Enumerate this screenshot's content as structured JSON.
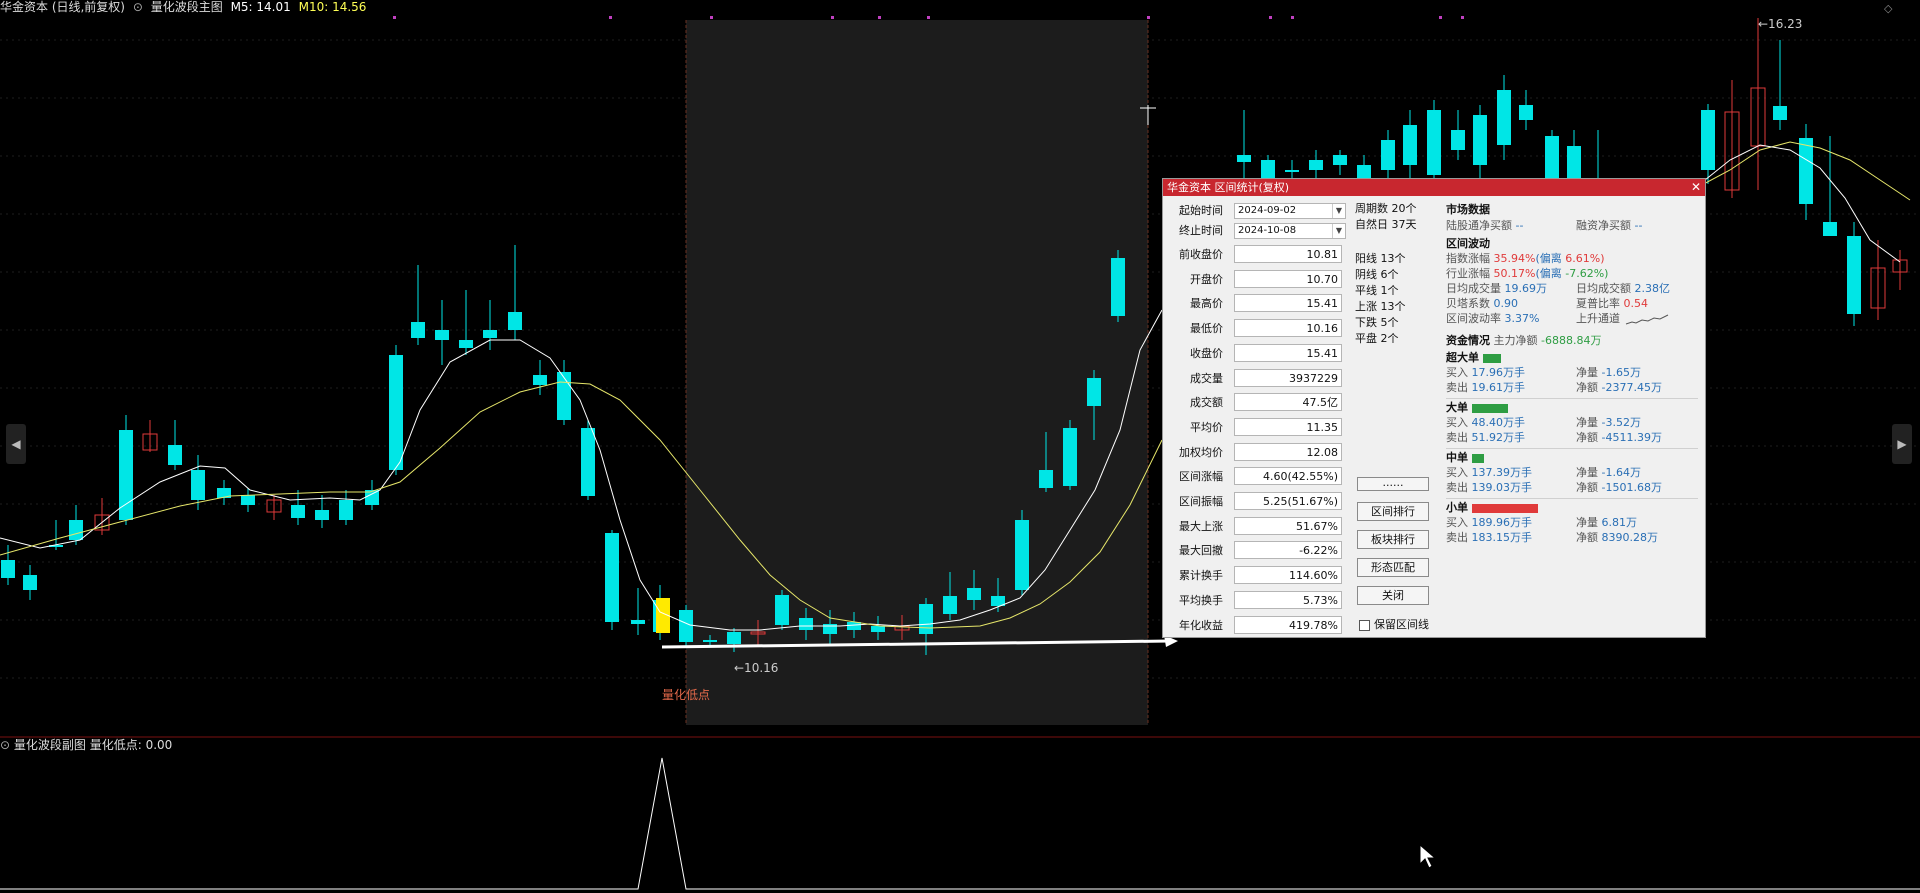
{
  "topbar": {
    "stock": "华金资本 (日线,前复权)",
    "indicator": "量化波段主图",
    "ma5": "M5: 14.01",
    "ma10": "M10: 14.56"
  },
  "subbar": {
    "indicator": "量化波段副图",
    "value": "量化低点: 0.00"
  },
  "chart_labels": {
    "low_point": "量化低点",
    "low_price": "←10.16",
    "high_price": "←16.23"
  },
  "colors": {
    "up": "#e03a3a",
    "down": "#00e6e6",
    "ma5": "#ffffff",
    "ma10": "#e6e66a",
    "dialog_title": "#c8272f"
  },
  "dialog": {
    "title": "华金资本 区间统计(复权)",
    "close": "✕",
    "start_label": "起始时间",
    "start_value": "2024-09-02",
    "end_label": "终止时间",
    "end_value": "2024-10-08",
    "fields": [
      {
        "label": "前收盘价",
        "value": "10.81"
      },
      {
        "label": "开盘价",
        "value": "10.70"
      },
      {
        "label": "最高价",
        "value": "15.41"
      },
      {
        "label": "最低价",
        "value": "10.16"
      },
      {
        "label": "收盘价",
        "value": "15.41"
      },
      {
        "label": "成交量",
        "value": "3937229"
      },
      {
        "label": "成交额",
        "value": "47.5亿"
      },
      {
        "label": "平均价",
        "value": "11.35"
      },
      {
        "label": "加权均价",
        "value": "12.08"
      },
      {
        "label": "区间涨幅",
        "value": "4.60(42.55%)"
      },
      {
        "label": "区间振幅",
        "value": "5.25(51.67%)"
      },
      {
        "label": "最大上涨",
        "value": "51.67%"
      },
      {
        "label": "最大回撤",
        "value": "-6.22%"
      },
      {
        "label": "累计换手",
        "value": "114.60%"
      },
      {
        "label": "平均换手",
        "value": "5.73%"
      },
      {
        "label": "年化收益",
        "value": "419.78%"
      }
    ],
    "stats_top": [
      "周期数 20个",
      "自然日 37天"
    ],
    "stats_mid": [
      "阳线 13个",
      "阴线 6个",
      "平线 1个",
      "上涨 13个",
      "下跌 5个",
      "平盘 2个"
    ],
    "buttons": {
      "more": "......",
      "range_rank": "区间排行",
      "sector_rank": "板块排行",
      "pattern": "形态匹配",
      "close": "关闭"
    },
    "keep_line": "保留区间线",
    "market": {
      "title": "市场数据",
      "hk_label": "陆股通净买额",
      "hk_value": "--",
      "margin_label": "融资净买额",
      "margin_value": "--"
    },
    "volatility": {
      "title": "区间波动",
      "index_label": "指数涨幅",
      "index_value": "35.94%",
      "index_dev": "(偏离",
      "index_dev_value": "6.61%)",
      "industry_label": "行业涨幅",
      "industry_value": "50.17%",
      "industry_dev": "(偏离",
      "industry_dev_value": "-7.62%)",
      "avg_vol_label": "日均成交量",
      "avg_vol_value": "19.69万",
      "avg_amt_label": "日均成交额",
      "avg_amt_value": "2.38亿",
      "beta_label": "贝塔系数",
      "beta_value": "0.90",
      "sharpe_label": "夏普比率",
      "sharpe_value": "0.54",
      "vol_rate_label": "区间波动率",
      "vol_rate_value": "3.37%",
      "channel": "上升通道"
    },
    "funds": {
      "title": "资金情况",
      "main_label": "主力净额",
      "main_value": "-6888.84万",
      "groups": [
        {
          "name": "超大单",
          "bar_color": "#2e9d43",
          "buy": "17.96万手",
          "sell": "19.61万手",
          "net_qty": "-1.65万",
          "net_amt": "-2377.45万"
        },
        {
          "name": "大单",
          "bar_color": "#2e9d43",
          "buy": "48.40万手",
          "sell": "51.92万手",
          "net_qty": "-3.52万",
          "net_amt": "-4511.39万"
        },
        {
          "name": "中单",
          "bar_color": "#2e9d43",
          "buy": "137.39万手",
          "sell": "139.03万手",
          "net_qty": "-1.64万",
          "net_amt": "-1501.68万"
        },
        {
          "name": "小单",
          "bar_color": "#e03a3a",
          "buy": "189.96万手",
          "sell": "183.15万手",
          "net_qty": "6.81万",
          "net_amt": "8390.28万"
        }
      ],
      "buy_label": "买入",
      "sell_label": "卖出",
      "net_label": "净量",
      "net_amt_label": "净额"
    }
  }
}
